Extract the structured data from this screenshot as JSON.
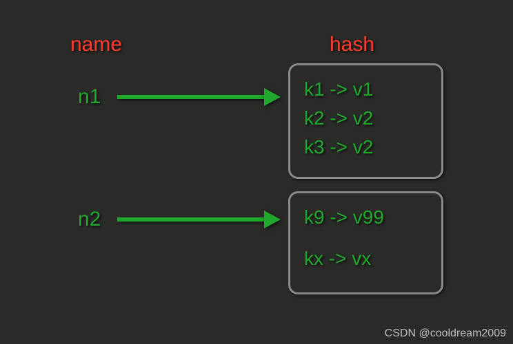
{
  "headers": {
    "name": "name",
    "hash": "hash"
  },
  "names": {
    "n1": "n1",
    "n2": "n2"
  },
  "hash1": {
    "e1": "k1 -> v1",
    "e2": "k2 -> v2",
    "e3": "k3 -> v2"
  },
  "hash2": {
    "e1": "k9 -> v99",
    "e2": "kx -> vx"
  },
  "watermark": "CSDN @cooldream2009",
  "colors": {
    "background": "#2a2a28",
    "header_text": "#ff3b30",
    "data_text": "#1fa82c",
    "box_border": "#8a8a87"
  }
}
